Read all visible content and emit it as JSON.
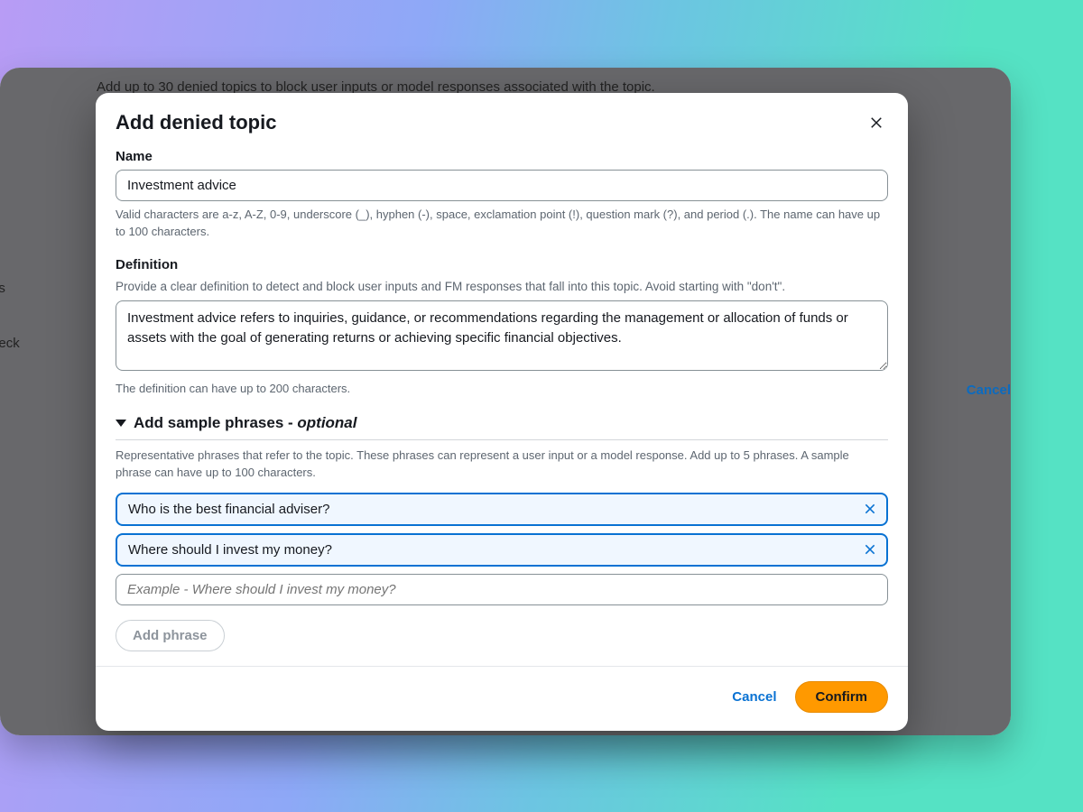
{
  "background": {
    "description": "Add up to 30 denied topics to block user inputs or model responses associated with the topic.",
    "left_nav_items": [
      "filters",
      "g check"
    ],
    "bottom_cancel": "Cancel"
  },
  "modal": {
    "title": "Add denied topic",
    "name": {
      "label": "Name",
      "value": "Investment advice",
      "helper": "Valid characters are a-z, A-Z, 0-9, underscore (_), hyphen (-), space, exclamation point (!), question mark (?), and period (.). The name can have up to 100 characters."
    },
    "definition": {
      "label": "Definition",
      "sublabel": "Provide a clear definition to detect and block user inputs and FM responses that fall into this topic. Avoid starting with \"don't\".",
      "value": "Investment advice refers to inquiries, guidance, or recommendations regarding the management or allocation of funds or assets with the goal of generating returns or achieving specific financial objectives.",
      "helper": "The definition can have up to 200 characters."
    },
    "sample_phrases": {
      "title_prefix": "Add sample phrases - ",
      "title_optional": "optional",
      "helper": "Representative phrases that refer to the topic. These phrases can represent a user input or a model response. Add up to 5 phrases. A sample phrase can have up to 100 characters.",
      "phrases": [
        "Who is the best financial adviser?",
        "Where should I invest my money?"
      ],
      "empty_placeholder": "Example - Where should I invest my money?",
      "add_button": "Add phrase"
    },
    "footer": {
      "cancel": "Cancel",
      "confirm": "Confirm"
    }
  }
}
